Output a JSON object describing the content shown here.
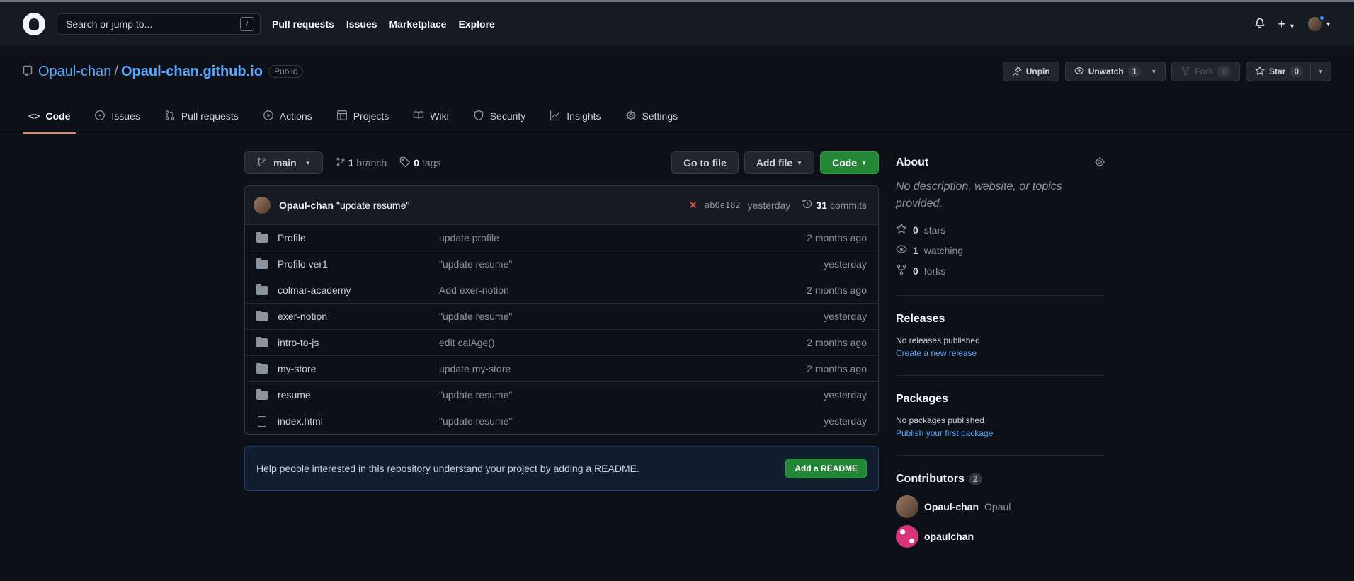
{
  "header": {
    "search_placeholder": "Search or jump to...",
    "search_shortcut": "/",
    "nav": [
      "Pull requests",
      "Issues",
      "Marketplace",
      "Explore"
    ]
  },
  "repo": {
    "owner": "Opaul-chan",
    "name": "Opaul-chan.github.io",
    "visibility": "Public",
    "unpin_label": "Unpin",
    "unwatch_label": "Unwatch",
    "watch_count": "1",
    "fork_label": "Fork",
    "fork_count": "0",
    "star_label": "Star",
    "star_count": "0"
  },
  "tabs": [
    {
      "label": "Code",
      "icon": "code-icon"
    },
    {
      "label": "Issues",
      "icon": "issue-icon"
    },
    {
      "label": "Pull requests",
      "icon": "pull-request-icon"
    },
    {
      "label": "Actions",
      "icon": "play-icon"
    },
    {
      "label": "Projects",
      "icon": "table-icon"
    },
    {
      "label": "Wiki",
      "icon": "book-icon"
    },
    {
      "label": "Security",
      "icon": "shield-icon"
    },
    {
      "label": "Insights",
      "icon": "graph-icon"
    },
    {
      "label": "Settings",
      "icon": "gear-icon"
    }
  ],
  "toolbar": {
    "branch": "main",
    "branch_count": "1",
    "branch_label": "branch",
    "tag_count": "0",
    "tag_label": "tags",
    "go_to_file": "Go to file",
    "add_file": "Add file",
    "code": "Code"
  },
  "commit": {
    "author": "Opaul-chan",
    "message": "\"update resume\"",
    "sha": "ab0e182",
    "time": "yesterday",
    "count": "31",
    "count_label": "commits"
  },
  "files": [
    {
      "name": "Profile",
      "type": "folder",
      "message": "update profile",
      "age": "2 months ago"
    },
    {
      "name": "Profilo ver1",
      "type": "folder",
      "message": "\"update resume\"",
      "age": "yesterday"
    },
    {
      "name": "colmar-academy",
      "type": "folder",
      "message": "Add exer-notion",
      "age": "2 months ago"
    },
    {
      "name": "exer-notion",
      "type": "folder",
      "message": "\"update resume\"",
      "age": "yesterday"
    },
    {
      "name": "intro-to-js",
      "type": "folder",
      "message": "edit calAge()",
      "age": "2 months ago"
    },
    {
      "name": "my-store",
      "type": "folder",
      "message": "update my-store",
      "age": "2 months ago"
    },
    {
      "name": "resume",
      "type": "folder",
      "message": "\"update resume\"",
      "age": "yesterday"
    },
    {
      "name": "index.html",
      "type": "file",
      "message": "\"update resume\"",
      "age": "yesterday"
    }
  ],
  "readme": {
    "text": "Help people interested in this repository understand your project by adding a README.",
    "button": "Add a README"
  },
  "about": {
    "title": "About",
    "description": "No description, website, or topics provided.",
    "stars_count": "0",
    "stars_label": "stars",
    "watching_count": "1",
    "watching_label": "watching",
    "forks_count": "0",
    "forks_label": "forks"
  },
  "releases": {
    "title": "Releases",
    "none": "No releases published",
    "link": "Create a new release"
  },
  "packages": {
    "title": "Packages",
    "none": "No packages published",
    "link": "Publish your first package"
  },
  "contributors": {
    "title": "Contributors",
    "count": "2",
    "list": [
      {
        "login": "Opaul-chan",
        "name": "Opaul"
      },
      {
        "login": "opaulchan",
        "name": ""
      }
    ]
  }
}
